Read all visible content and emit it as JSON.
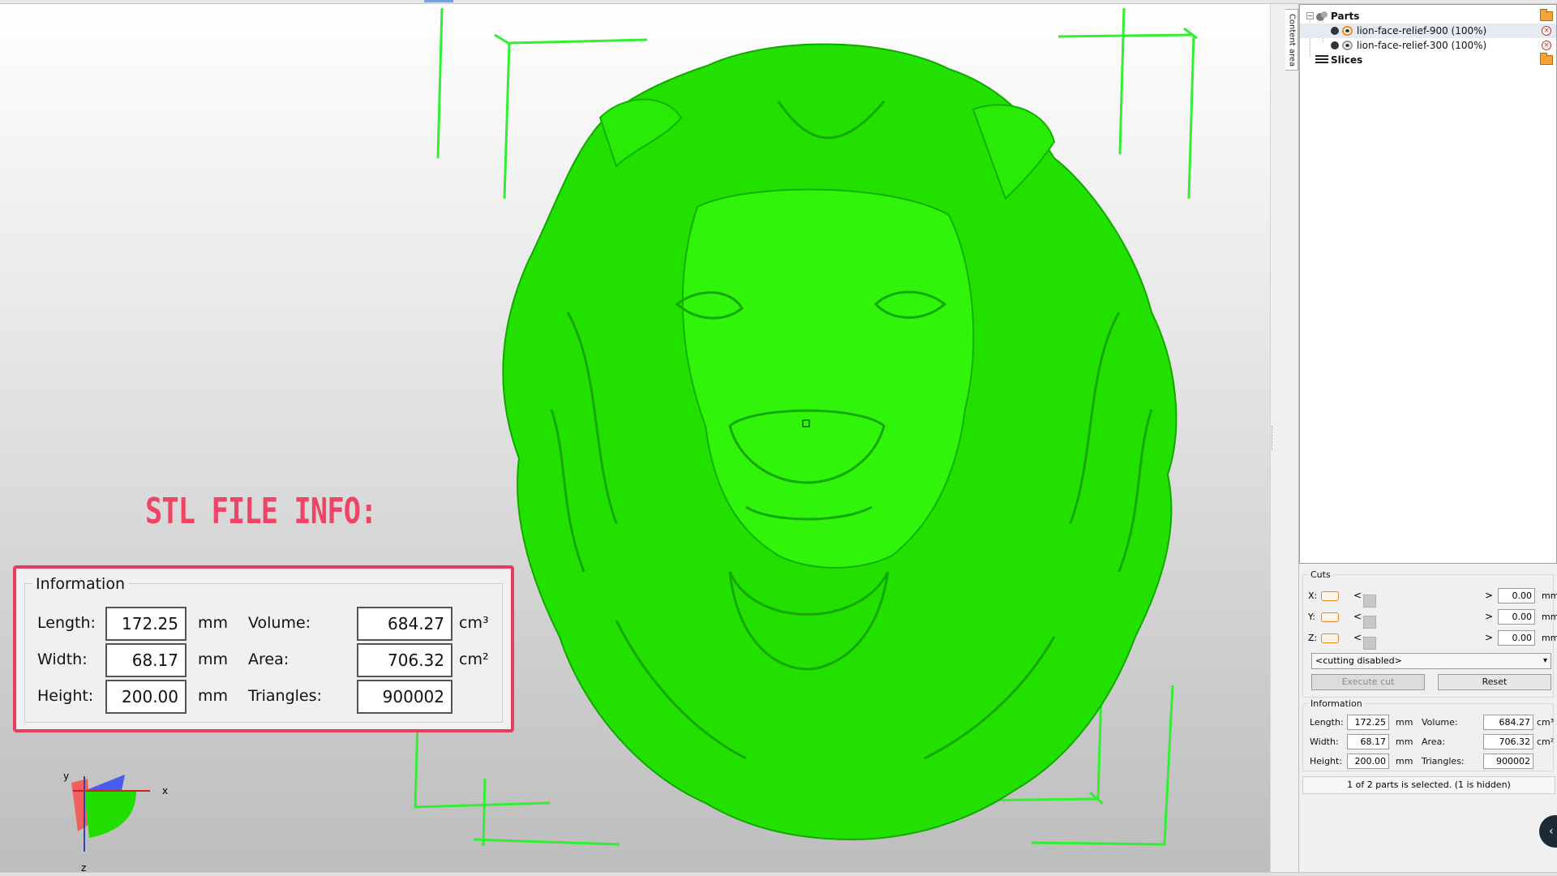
{
  "right_panel": {
    "content_tab_label": "Content area",
    "tree": {
      "parts_label": "Parts",
      "slices_label": "Slices",
      "items": [
        {
          "label": "lion-face-relief-900 (100%)"
        },
        {
          "label": "lion-face-relief-300 (100%)"
        }
      ]
    },
    "cuts": {
      "title": "Cuts",
      "rows": [
        {
          "axis": "X:",
          "value": "0.00",
          "unit": "mm"
        },
        {
          "axis": "Y:",
          "value": "0.00",
          "unit": "mm"
        },
        {
          "axis": "Z:",
          "value": "0.00",
          "unit": "mm"
        }
      ],
      "mode_select": "<cutting disabled>",
      "execute_label": "Execute cut",
      "reset_label": "Reset"
    },
    "information": {
      "title": "Information",
      "length_label": "Length:",
      "length": "172.25",
      "width_label": "Width:",
      "width": "68.17",
      "height_label": "Height:",
      "height": "200.00",
      "length_unit": "mm",
      "volume_label": "Volume:",
      "volume": "684.27",
      "volume_unit": "cm³",
      "area_label": "Area:",
      "area": "706.32",
      "area_unit": "cm²",
      "triangles_label": "Triangles:",
      "triangles": "900002"
    },
    "status": "1 of 2 parts is selected. (1 is hidden)"
  },
  "annotation": {
    "title": "STL FILE INFO:",
    "box": {
      "title": "Information",
      "length_label": "Length:",
      "length": "172.25",
      "width_label": "Width:",
      "width": "68.17",
      "height_label": "Height:",
      "height": "200.00",
      "length_unit": "mm",
      "volume_label": "Volume:",
      "volume": "684.27",
      "volume_unit": "cm³",
      "area_label": "Area:",
      "area": "706.32",
      "area_unit": "cm²",
      "triangles_label": "Triangles:",
      "triangles": "900002"
    }
  },
  "viewport": {
    "model_color": "#22e000",
    "guide_color": "#33ee33",
    "axis_labels": {
      "x": "x",
      "y": "y",
      "z": "z"
    }
  }
}
